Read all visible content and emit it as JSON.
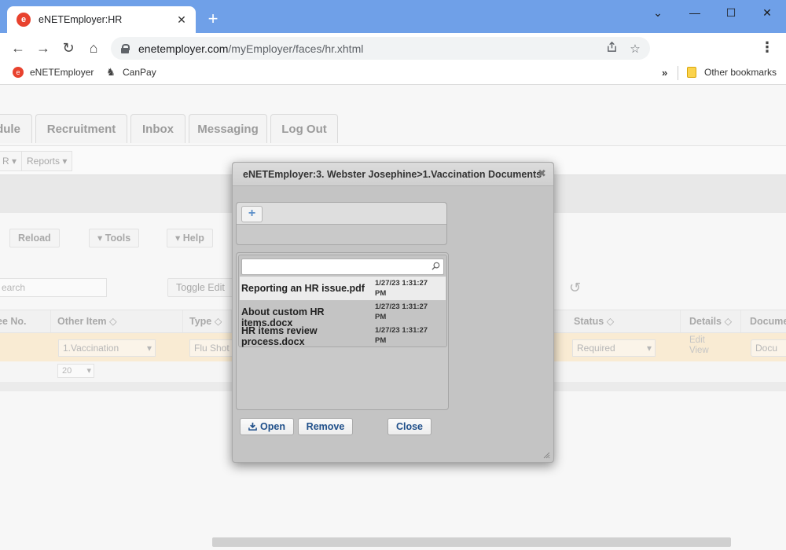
{
  "browser": {
    "tab_title": "eNETEmployer:HR",
    "favicon_letter": "e",
    "url_host": "enetemployer.com",
    "url_path": "/myEmployer/faces/hr.xhtml",
    "new_tab": "+",
    "tab_close": "✕",
    "window": {
      "minimize": "﹀",
      "maximize": "☐",
      "close": "✕",
      "down": "⌄"
    },
    "nav": {
      "back": "←",
      "forward": "→",
      "reload": "↻",
      "home": "⌂"
    },
    "bookmarks": [
      {
        "label": "eNETEmployer",
        "icon": "enet-logo-icon"
      },
      {
        "label": "CanPay",
        "icon": "canpay-icon"
      }
    ],
    "bookmarks_more": "»",
    "other_bookmarks": "Other bookmarks",
    "accent_color": "#6fa0e8"
  },
  "app": {
    "tabs": [
      "dule",
      "Recruitment",
      "Inbox",
      "Messaging",
      "Log Out"
    ],
    "submenus": [
      "R",
      "Reports"
    ],
    "actions": [
      "Reload",
      "Tools",
      "Help"
    ],
    "search_placeholder": "earch",
    "toggle_edit": "Toggle Edit",
    "columns": [
      "ee No.",
      "Other Item",
      "Type",
      "Status",
      "Details",
      "Docume"
    ],
    "row": {
      "other_item": "1.Vaccination",
      "type": "Flu Shot",
      "status": "Required",
      "details_edit": "Edit",
      "details_view": "View",
      "document": "Docu"
    },
    "page_size": "20"
  },
  "modal": {
    "title": "eNETEmployer:3. Webster Josephine>1.Vaccination Documents",
    "close": "✖",
    "add": "+",
    "files": [
      {
        "name": "Reporting an HR issue.pdf",
        "date": "1/27/23 1:31:27",
        "ampm": "PM",
        "selected": true
      },
      {
        "name": "About custom HR items.docx",
        "date": "1/27/23 1:31:27",
        "ampm": "PM",
        "selected": false
      },
      {
        "name": "HR items review process.docx",
        "date": "1/27/23 1:31:27",
        "ampm": "PM",
        "selected": false
      }
    ],
    "buttons": {
      "open": "Open",
      "remove": "Remove",
      "close": "Close"
    }
  }
}
